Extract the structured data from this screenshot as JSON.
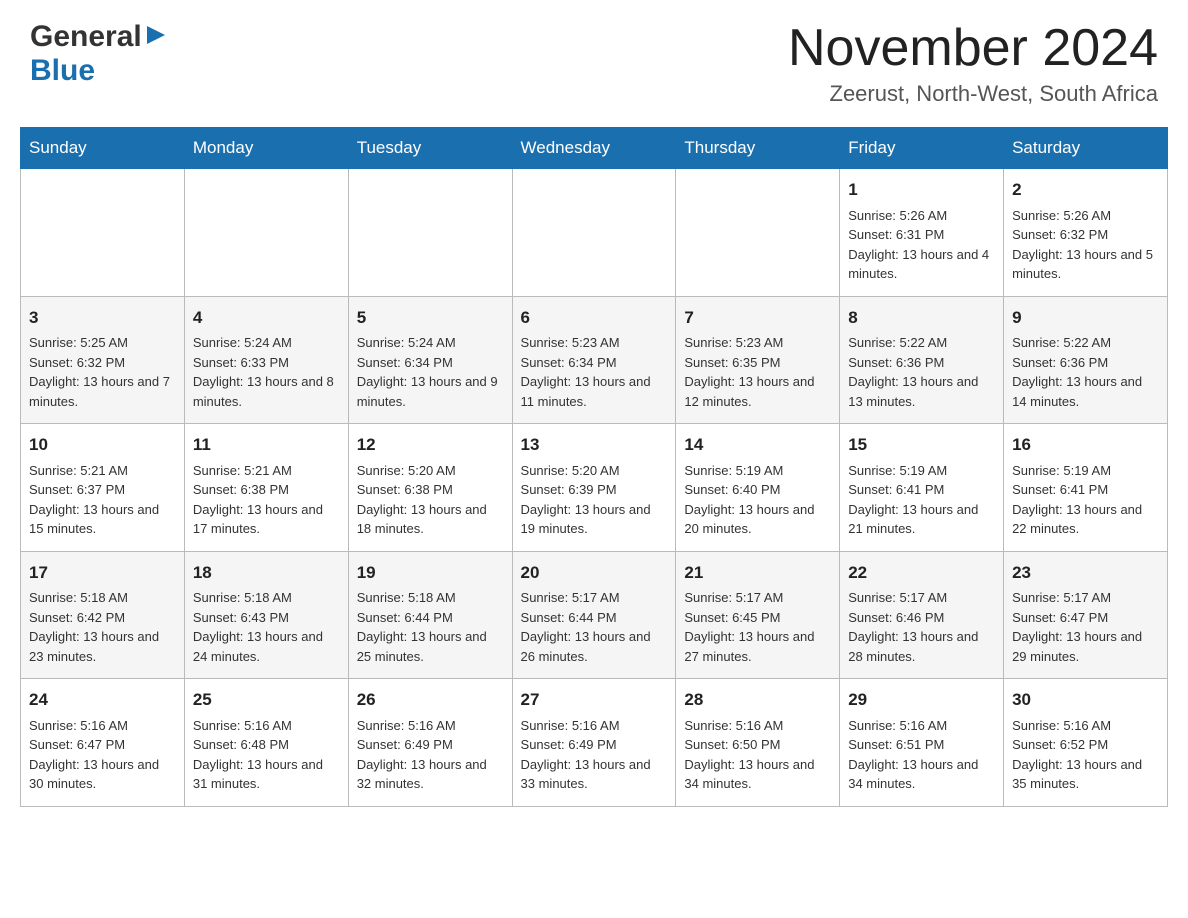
{
  "header": {
    "logo_general": "General",
    "logo_blue": "Blue",
    "month_year": "November 2024",
    "location": "Zeerust, North-West, South Africa"
  },
  "calendar": {
    "days_of_week": [
      "Sunday",
      "Monday",
      "Tuesday",
      "Wednesday",
      "Thursday",
      "Friday",
      "Saturday"
    ],
    "weeks": [
      [
        {
          "day": "",
          "info": ""
        },
        {
          "day": "",
          "info": ""
        },
        {
          "day": "",
          "info": ""
        },
        {
          "day": "",
          "info": ""
        },
        {
          "day": "",
          "info": ""
        },
        {
          "day": "1",
          "info": "Sunrise: 5:26 AM\nSunset: 6:31 PM\nDaylight: 13 hours and 4 minutes."
        },
        {
          "day": "2",
          "info": "Sunrise: 5:26 AM\nSunset: 6:32 PM\nDaylight: 13 hours and 5 minutes."
        }
      ],
      [
        {
          "day": "3",
          "info": "Sunrise: 5:25 AM\nSunset: 6:32 PM\nDaylight: 13 hours and 7 minutes."
        },
        {
          "day": "4",
          "info": "Sunrise: 5:24 AM\nSunset: 6:33 PM\nDaylight: 13 hours and 8 minutes."
        },
        {
          "day": "5",
          "info": "Sunrise: 5:24 AM\nSunset: 6:34 PM\nDaylight: 13 hours and 9 minutes."
        },
        {
          "day": "6",
          "info": "Sunrise: 5:23 AM\nSunset: 6:34 PM\nDaylight: 13 hours and 11 minutes."
        },
        {
          "day": "7",
          "info": "Sunrise: 5:23 AM\nSunset: 6:35 PM\nDaylight: 13 hours and 12 minutes."
        },
        {
          "day": "8",
          "info": "Sunrise: 5:22 AM\nSunset: 6:36 PM\nDaylight: 13 hours and 13 minutes."
        },
        {
          "day": "9",
          "info": "Sunrise: 5:22 AM\nSunset: 6:36 PM\nDaylight: 13 hours and 14 minutes."
        }
      ],
      [
        {
          "day": "10",
          "info": "Sunrise: 5:21 AM\nSunset: 6:37 PM\nDaylight: 13 hours and 15 minutes."
        },
        {
          "day": "11",
          "info": "Sunrise: 5:21 AM\nSunset: 6:38 PM\nDaylight: 13 hours and 17 minutes."
        },
        {
          "day": "12",
          "info": "Sunrise: 5:20 AM\nSunset: 6:38 PM\nDaylight: 13 hours and 18 minutes."
        },
        {
          "day": "13",
          "info": "Sunrise: 5:20 AM\nSunset: 6:39 PM\nDaylight: 13 hours and 19 minutes."
        },
        {
          "day": "14",
          "info": "Sunrise: 5:19 AM\nSunset: 6:40 PM\nDaylight: 13 hours and 20 minutes."
        },
        {
          "day": "15",
          "info": "Sunrise: 5:19 AM\nSunset: 6:41 PM\nDaylight: 13 hours and 21 minutes."
        },
        {
          "day": "16",
          "info": "Sunrise: 5:19 AM\nSunset: 6:41 PM\nDaylight: 13 hours and 22 minutes."
        }
      ],
      [
        {
          "day": "17",
          "info": "Sunrise: 5:18 AM\nSunset: 6:42 PM\nDaylight: 13 hours and 23 minutes."
        },
        {
          "day": "18",
          "info": "Sunrise: 5:18 AM\nSunset: 6:43 PM\nDaylight: 13 hours and 24 minutes."
        },
        {
          "day": "19",
          "info": "Sunrise: 5:18 AM\nSunset: 6:44 PM\nDaylight: 13 hours and 25 minutes."
        },
        {
          "day": "20",
          "info": "Sunrise: 5:17 AM\nSunset: 6:44 PM\nDaylight: 13 hours and 26 minutes."
        },
        {
          "day": "21",
          "info": "Sunrise: 5:17 AM\nSunset: 6:45 PM\nDaylight: 13 hours and 27 minutes."
        },
        {
          "day": "22",
          "info": "Sunrise: 5:17 AM\nSunset: 6:46 PM\nDaylight: 13 hours and 28 minutes."
        },
        {
          "day": "23",
          "info": "Sunrise: 5:17 AM\nSunset: 6:47 PM\nDaylight: 13 hours and 29 minutes."
        }
      ],
      [
        {
          "day": "24",
          "info": "Sunrise: 5:16 AM\nSunset: 6:47 PM\nDaylight: 13 hours and 30 minutes."
        },
        {
          "day": "25",
          "info": "Sunrise: 5:16 AM\nSunset: 6:48 PM\nDaylight: 13 hours and 31 minutes."
        },
        {
          "day": "26",
          "info": "Sunrise: 5:16 AM\nSunset: 6:49 PM\nDaylight: 13 hours and 32 minutes."
        },
        {
          "day": "27",
          "info": "Sunrise: 5:16 AM\nSunset: 6:49 PM\nDaylight: 13 hours and 33 minutes."
        },
        {
          "day": "28",
          "info": "Sunrise: 5:16 AM\nSunset: 6:50 PM\nDaylight: 13 hours and 34 minutes."
        },
        {
          "day": "29",
          "info": "Sunrise: 5:16 AM\nSunset: 6:51 PM\nDaylight: 13 hours and 34 minutes."
        },
        {
          "day": "30",
          "info": "Sunrise: 5:16 AM\nSunset: 6:52 PM\nDaylight: 13 hours and 35 minutes."
        }
      ]
    ]
  }
}
